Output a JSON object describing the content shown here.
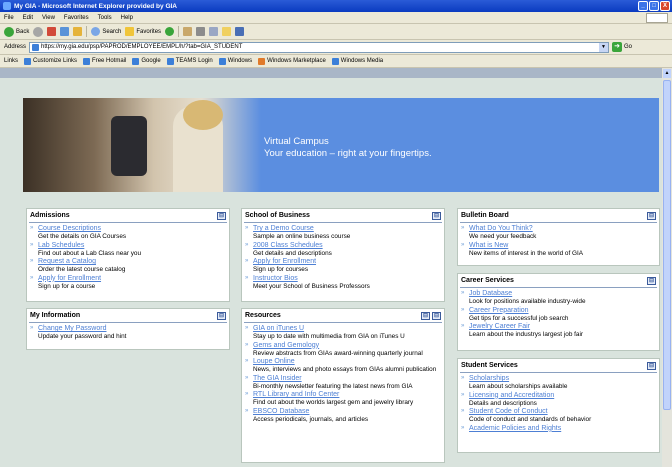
{
  "window": {
    "title": "My GIA - Microsoft Internet Explorer provided by GIA",
    "min": "_",
    "max": "□",
    "close": "X"
  },
  "menu": [
    "File",
    "Edit",
    "View",
    "Favorites",
    "Tools",
    "Help"
  ],
  "toolbar": {
    "back": "Back",
    "search": "Search",
    "favorites": "Favorites"
  },
  "address": {
    "label": "Address",
    "url": "https://my.gia.edu/psp/PAPROD/EMPLOYEE/EMPL/h/?tab=GIA_STUDENT",
    "go": "Go"
  },
  "links": {
    "label": "Links",
    "items": [
      "Customize Links",
      "Free Hotmail",
      "Google",
      "TEAMS Login",
      "Windows",
      "Windows Marketplace",
      "Windows Media"
    ]
  },
  "banner": {
    "line1": "Virtual Campus",
    "line2": "Your education – right at your fingertips."
  },
  "admissions": {
    "title": "Admissions",
    "items": [
      {
        "link": "Course Descriptions",
        "desc": "Get the details on GIA Courses"
      },
      {
        "link": "Lab Schedules",
        "desc": "Find out about a Lab Class near you"
      },
      {
        "link": "Request a Catalog",
        "desc": "Order the latest course catalog"
      },
      {
        "link": "Apply for Enrollment",
        "desc": "Sign up for a course"
      }
    ]
  },
  "my_information": {
    "title": "My Information",
    "items": [
      {
        "link": "Change My Password",
        "desc": "Update your password and hint"
      }
    ]
  },
  "school_of_business": {
    "title": "School of Business",
    "items": [
      {
        "link": "Try a Demo Course",
        "desc": "Sample an online business course"
      },
      {
        "link": "2008 Class Schedules",
        "desc": "Get details and descriptions"
      },
      {
        "link": "Apply for Enrollment",
        "desc": "Sign up for courses"
      },
      {
        "link": "Instructor Bios",
        "desc": "Meet your School of Business Professors"
      }
    ]
  },
  "resources": {
    "title": "Resources",
    "items": [
      {
        "link": "GIA on iTunes U",
        "desc": "Stay up to date with multimedia from GIA on iTunes U"
      },
      {
        "link": "Gems and Gemology",
        "desc": "Review abstracts from GIAs award-winning quarterly journal"
      },
      {
        "link": "Loupe Online",
        "desc": "News, interviews and photo essays from GIAs alumni publication"
      },
      {
        "link": "The GIA Insider",
        "desc": "Bi-monthly newsletter featuring the latest news from GIA"
      },
      {
        "link": "RTL Library and Info Center",
        "desc": "Find out about the worlds largest gem and jewelry library"
      },
      {
        "link": "EBSCO Database",
        "desc": "Access periodicals, journals, and articles"
      }
    ]
  },
  "bulletin_board": {
    "title": "Bulletin Board",
    "items": [
      {
        "link": "What Do You Think?",
        "desc": "We need your feedback"
      },
      {
        "link": "What is New",
        "desc": "New items of interest in the world of GIA"
      }
    ]
  },
  "career_services": {
    "title": "Career Services",
    "items": [
      {
        "link": "Job Database",
        "desc": "Look for positions available industry-wide"
      },
      {
        "link": "Career Preparation",
        "desc": "Get tips for a successful job search"
      },
      {
        "link": "Jewelry Career Fair",
        "desc": "Learn about the industrys largest job fair"
      }
    ]
  },
  "student_services": {
    "title": "Student Services",
    "items": [
      {
        "link": "Scholarships",
        "desc": "Learn about scholarships available"
      },
      {
        "link": "Licensing and Accreditation",
        "desc": "Details and descriptions"
      },
      {
        "link": "Student Code of Conduct",
        "desc": "Code of conduct and standards of behavior"
      },
      {
        "link": "Academic Policies and Rights",
        "desc": ""
      }
    ]
  },
  "panel_icons": {
    "collapse": "⊟",
    "close": "⊟"
  },
  "colors": {
    "link": "#4d7fd4",
    "banner": "#5b8ee0",
    "bg": "#d9e3dd"
  }
}
